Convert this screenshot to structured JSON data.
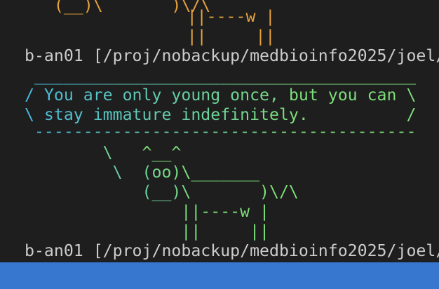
{
  "terminal": {
    "prev_cow_tail": {
      "line1": "   (__)\\       )\\/\\",
      "line2": "       ||----w |",
      "line3": "       ||     ||"
    },
    "prompt1": "b-an01 [/proj/nobackup/medbioinfo2025/joel/",
    "speech": {
      "top": " _______________________________________",
      "l1": "/ You are only young once, but you can \\",
      "l2": "\\ stay immature indefinitely.          /",
      "bottom": " ---------------------------------------"
    },
    "cow": {
      "l1": "        \\   ^__^",
      "l2": "         \\  (oo)\\_______",
      "l3": "            (__)\\       )\\/\\",
      "l4": "                ||----w |",
      "l5": "                ||     ||"
    },
    "prompt2": "b-an01 [/proj/nobackup/medbioinfo2025/joel/"
  },
  "colors": {
    "background": "#1e1e1e",
    "cow_orange": "#e8a33d",
    "gradient_start": "#4ab9e0",
    "gradient_end": "#7ee07a",
    "status_bar": "#3877d0",
    "prompt_text": "#cccccc"
  }
}
